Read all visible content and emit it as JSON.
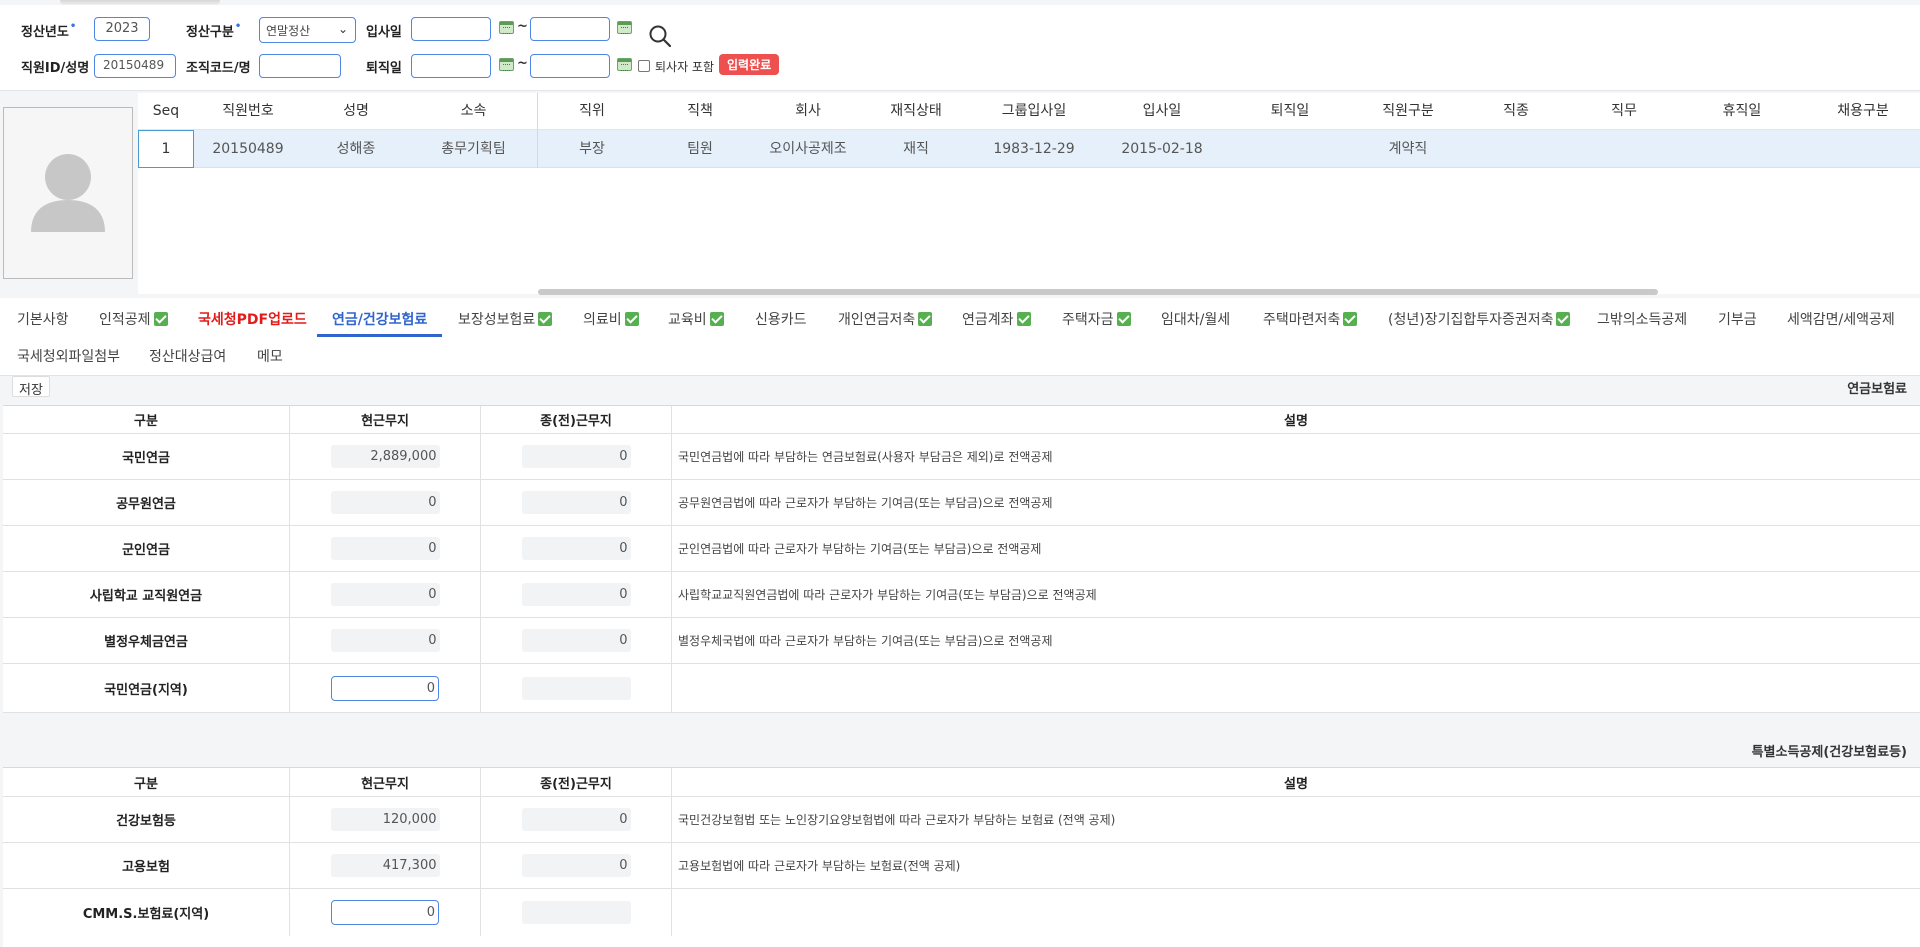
{
  "filters": {
    "year_label": "정산년도",
    "year_value": "2023",
    "settle_type_label": "정산구분",
    "settle_type_value": "연말정산",
    "hire_date_label": "입사일",
    "employee_label": "직원ID/성명",
    "employee_value": "20150489",
    "org_label": "조직코드/명",
    "retire_date_label": "퇴직일",
    "tilde": "~",
    "include_retired_label": "퇴사자 포함",
    "status_badge": "입력완료"
  },
  "grid": {
    "headers": [
      "Seq",
      "직원번호",
      "성명",
      "소속",
      "직위",
      "직책",
      "회사",
      "재직상태",
      "그룹입사일",
      "입사일",
      "퇴직일",
      "직원구분",
      "직종",
      "직무",
      "휴직일",
      "채용구분"
    ],
    "row": {
      "seq": "1",
      "emp_no": "20150489",
      "name": "성해종",
      "dept": "총무기획팀",
      "position": "부장",
      "title": "팀원",
      "company": "오이사공제조",
      "status": "재직",
      "group_join": "1983-12-29",
      "join": "2015-02-18",
      "retire": "",
      "emp_type": "계약직",
      "job_class": "",
      "job_duty": "",
      "leave": "",
      "hire_type": ""
    }
  },
  "tabs": [
    {
      "label": "기본사항"
    },
    {
      "label": "인적공제"
    },
    {
      "label": "국세청PDF업로드"
    },
    {
      "label": "연금/건강보험료"
    },
    {
      "label": "보장성보험료"
    },
    {
      "label": "의료비"
    },
    {
      "label": "교육비"
    },
    {
      "label": "신용카드"
    },
    {
      "label": "개인연금저축"
    },
    {
      "label": "연금계좌"
    },
    {
      "label": "주택자금"
    },
    {
      "label": "임대차/월세"
    },
    {
      "label": "주택마련저축"
    },
    {
      "label": "(청년)장기집합투자증권저축"
    },
    {
      "label": "그밖의소득공제"
    },
    {
      "label": "기부금"
    },
    {
      "label": "세액감면/세액공제"
    },
    {
      "label": "국세청외파일첨부"
    },
    {
      "label": "정산대상급여"
    },
    {
      "label": "메모"
    }
  ],
  "save_label": "저장",
  "pension": {
    "title": "연금보험료",
    "headers": {
      "c1": "구분",
      "c2": "현근무지",
      "c3": "종(전)근무지",
      "c4": "설명"
    },
    "rows": [
      {
        "label": "국민연금",
        "current": "2,889,000",
        "previous": "0",
        "desc": "국민연금법에 따라 부담하는 연금보험료(사용자 부담금은 제외)로 전액공제"
      },
      {
        "label": "공무원연금",
        "current": "0",
        "previous": "0",
        "desc": "공무원연금법에 따라 근로자가 부담하는 기여금(또는 부담금)으로 전액공제"
      },
      {
        "label": "군인연금",
        "current": "0",
        "previous": "0",
        "desc": "군인연금법에 따라 근로자가 부담하는 기여금(또는 부담금)으로 전액공제"
      },
      {
        "label": "사립학교 교직원연금",
        "current": "0",
        "previous": "0",
        "desc": "사립학교교직원연금법에 따라 근로자가 부담하는 기여금(또는 부담금)으로 전액공제"
      },
      {
        "label": "별정우체금연금",
        "current": "0",
        "previous": "0",
        "desc": "별정우체국법에 따라 근로자가 부담하는 기여금(또는 부담금)으로 전액공제"
      },
      {
        "label": "국민연금(지역)",
        "current": "0",
        "previous": "",
        "desc": ""
      }
    ]
  },
  "health": {
    "title": "특별소득공제(건강보험료등)",
    "headers": {
      "c1": "구분",
      "c2": "현근무지",
      "c3": "종(전)근무지",
      "c4": "설명"
    },
    "rows": [
      {
        "label": "건강보험등",
        "current": "120,000",
        "previous": "0",
        "desc": "국민건강보험법 또는 노인장기요양보험법에 따라 근로자가 부담하는 보험료 (전액 공제)"
      },
      {
        "label": "고용보험",
        "current": "417,300",
        "previous": "0",
        "desc": "고용보험법에 따라 근로자가 부담하는 보험료(전액 공제)"
      },
      {
        "label": "CMM.S.보험료(지역)",
        "current": "0",
        "previous": "",
        "desc": ""
      }
    ]
  }
}
